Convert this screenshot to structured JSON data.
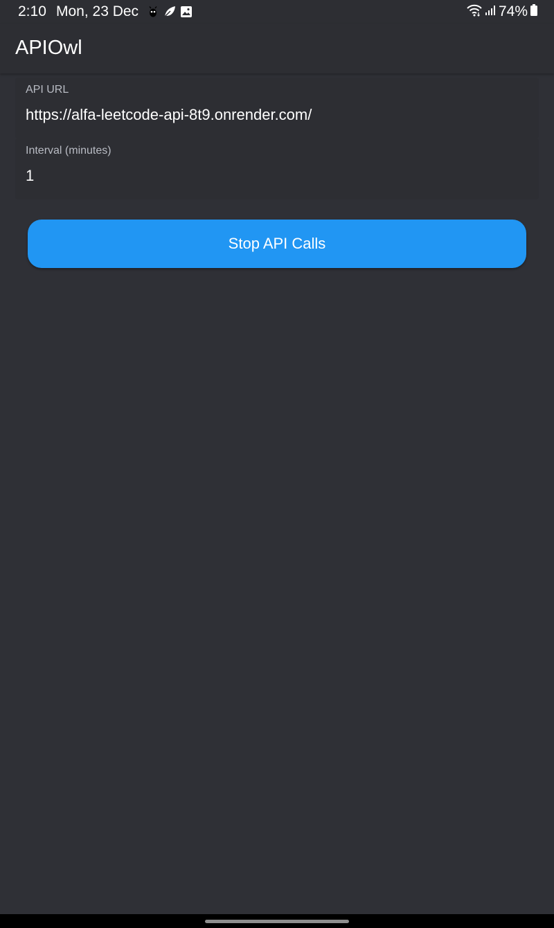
{
  "status_bar": {
    "time": "2:10",
    "date": "Mon, 23 Dec",
    "notification_icons": [
      "bug-icon",
      "leaf-icon",
      "image-icon"
    ],
    "system_icons": [
      "wifi-icon",
      "signal-icon",
      "battery-icon"
    ],
    "battery": "74%"
  },
  "app_bar": {
    "title": "APIOwl"
  },
  "form": {
    "api_url": {
      "label": "API URL",
      "value": "https://alfa-leetcode-api-8t9.onrender.com/"
    },
    "interval": {
      "label": "Interval (minutes)",
      "value": "1"
    }
  },
  "actions": {
    "stop_label": "Stop API Calls"
  },
  "colors": {
    "background": "#2f3036",
    "surface": "#2d2e33",
    "accent": "#2196f3",
    "label": "#b9bcc4"
  }
}
